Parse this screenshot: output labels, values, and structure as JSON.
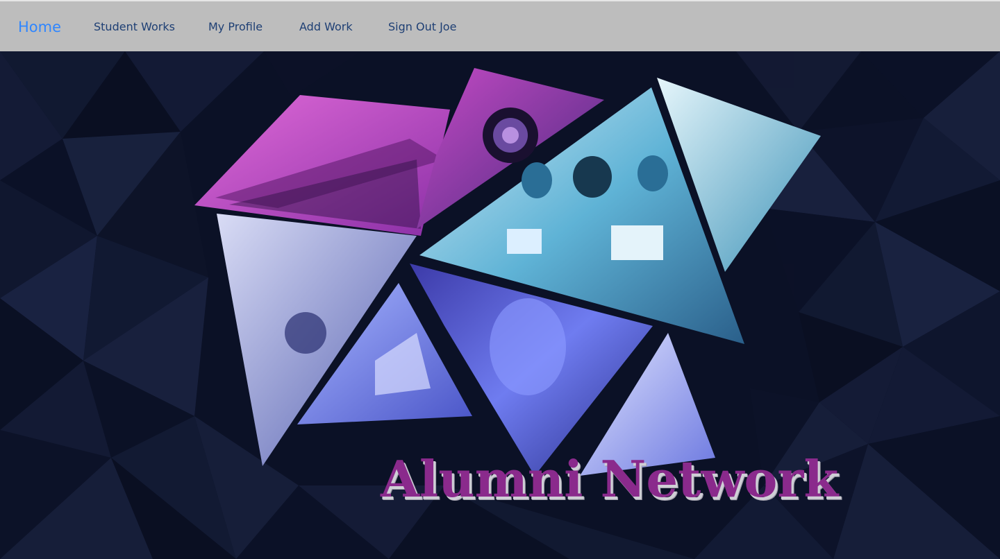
{
  "nav": {
    "home": "Home",
    "student_works": "Student Works",
    "my_profile": "My Profile",
    "add_work": "Add Work",
    "sign_out": "Sign Out Joe"
  },
  "hero": {
    "title": "Alumni Network"
  },
  "colors": {
    "nav_bg": "#bdbdbd",
    "nav_text": "#1e3f74",
    "nav_active": "#2f86ff",
    "hero_bg": "#0a1024",
    "title": "#8a2a8c"
  }
}
